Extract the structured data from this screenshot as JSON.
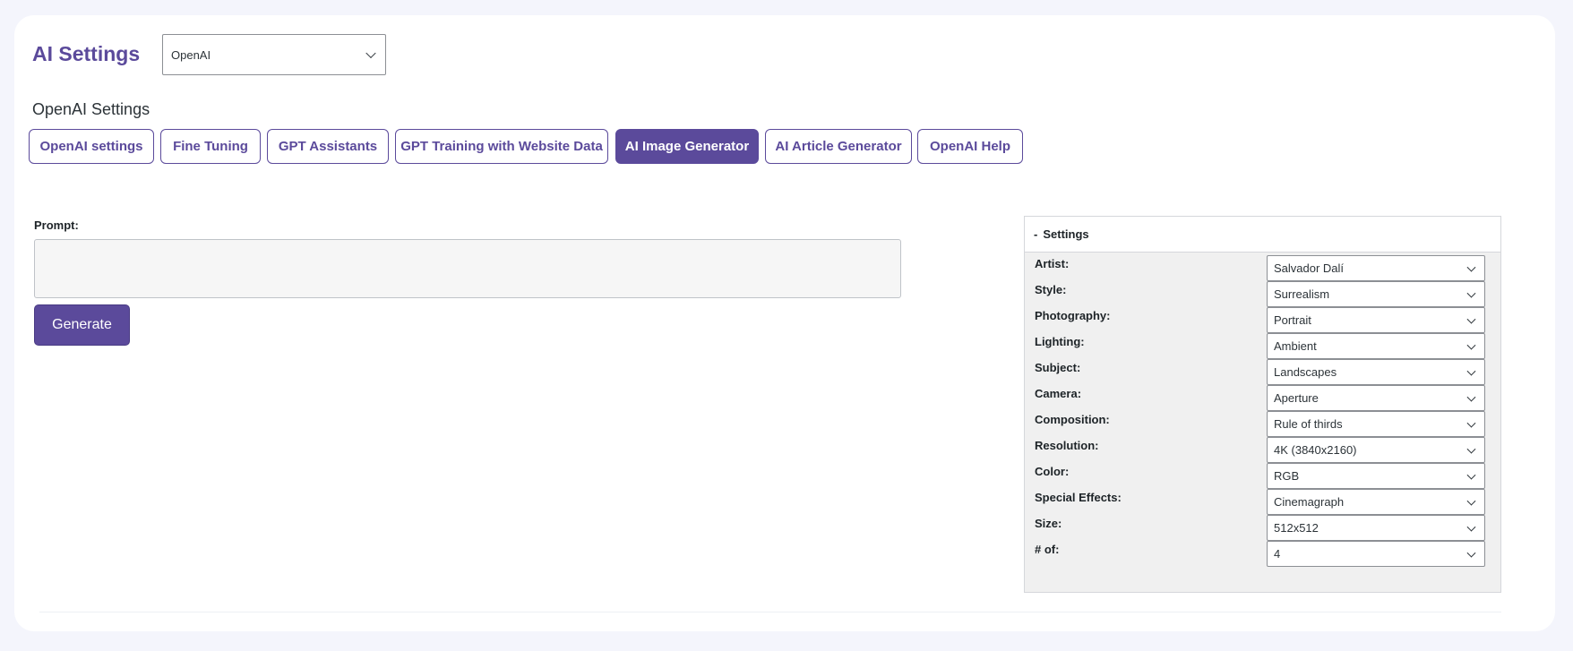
{
  "header": {
    "title": "AI Settings",
    "provider_value": "OpenAI",
    "section_title": "OpenAI Settings"
  },
  "tabs": [
    {
      "label": "OpenAI settings",
      "active": false
    },
    {
      "label": "Fine Tuning",
      "active": false
    },
    {
      "label": "GPT Assistants",
      "active": false
    },
    {
      "label": "GPT Training with Website Data",
      "active": false
    },
    {
      "label": "AI Image Generator",
      "active": true
    },
    {
      "label": "AI Article Generator",
      "active": false
    },
    {
      "label": "OpenAI Help",
      "active": false
    }
  ],
  "prompt": {
    "label": "Prompt:",
    "value": "",
    "button_label": "Generate"
  },
  "settings": {
    "toggle": "-",
    "title": "Settings",
    "rows": [
      {
        "label": "Artist:",
        "value": "Salvador Dalí"
      },
      {
        "label": "Style:",
        "value": "Surrealism"
      },
      {
        "label": "Photography:",
        "value": "Portrait"
      },
      {
        "label": "Lighting:",
        "value": "Ambient"
      },
      {
        "label": "Subject:",
        "value": "Landscapes"
      },
      {
        "label": "Camera:",
        "value": "Aperture"
      },
      {
        "label": "Composition:",
        "value": "Rule of thirds"
      },
      {
        "label": "Resolution:",
        "value": "4K (3840x2160)"
      },
      {
        "label": "Color:",
        "value": "RGB"
      },
      {
        "label": "Special Effects:",
        "value": "Cinemagraph"
      },
      {
        "label": "Size:",
        "value": "512x512"
      },
      {
        "label": "# of:",
        "value": "4"
      }
    ]
  },
  "colors": {
    "accent": "#5b4a9b",
    "page_background": "#f4f5fc",
    "panel_background": "#f0f0f0"
  }
}
